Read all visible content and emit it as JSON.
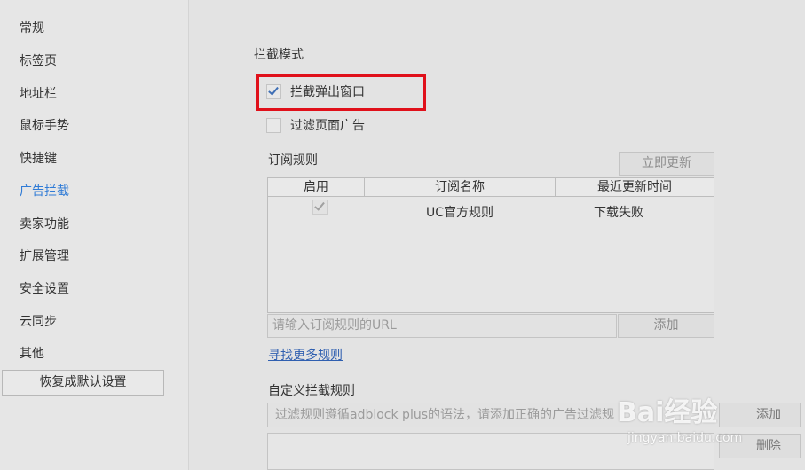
{
  "sidebar": {
    "items": [
      {
        "label": "常规"
      },
      {
        "label": "标签页"
      },
      {
        "label": "地址栏"
      },
      {
        "label": "鼠标手势"
      },
      {
        "label": "快捷键"
      },
      {
        "label": "广告拦截",
        "active": true
      },
      {
        "label": "卖家功能"
      },
      {
        "label": "扩展管理"
      },
      {
        "label": "安全设置"
      },
      {
        "label": "云同步"
      },
      {
        "label": "其他"
      }
    ],
    "restore_label": "恢复成默认设置"
  },
  "main": {
    "section_title": "拦截模式",
    "block_popups": {
      "label": "拦截弹出窗口",
      "checked": true
    },
    "filter_ads": {
      "label": "过滤页面广告",
      "checked": false
    },
    "subscriptions": {
      "title": "订阅规则",
      "update_label": "立即更新",
      "columns": [
        "启用",
        "订阅名称",
        "最近更新时间"
      ],
      "rows": [
        {
          "enabled": true,
          "name": "UC官方规则",
          "updated": "下载失败"
        }
      ],
      "url_placeholder": "请输入订阅规则的URL",
      "add_label": "添加",
      "more_link": "寻找更多规则"
    },
    "custom": {
      "title": "自定义拦截规则",
      "placeholder": "过滤规则遵循adblock plus的语法，请添加正确的广告过滤规",
      "add_label": "添加",
      "delete_label": "删除"
    }
  },
  "watermark": {
    "logo": "Bai经验",
    "url": "jingyan.baidu.com"
  },
  "colors": {
    "highlight": "#e0101a",
    "active_nav": "#2f7bd6",
    "link": "#2f5fb0"
  }
}
